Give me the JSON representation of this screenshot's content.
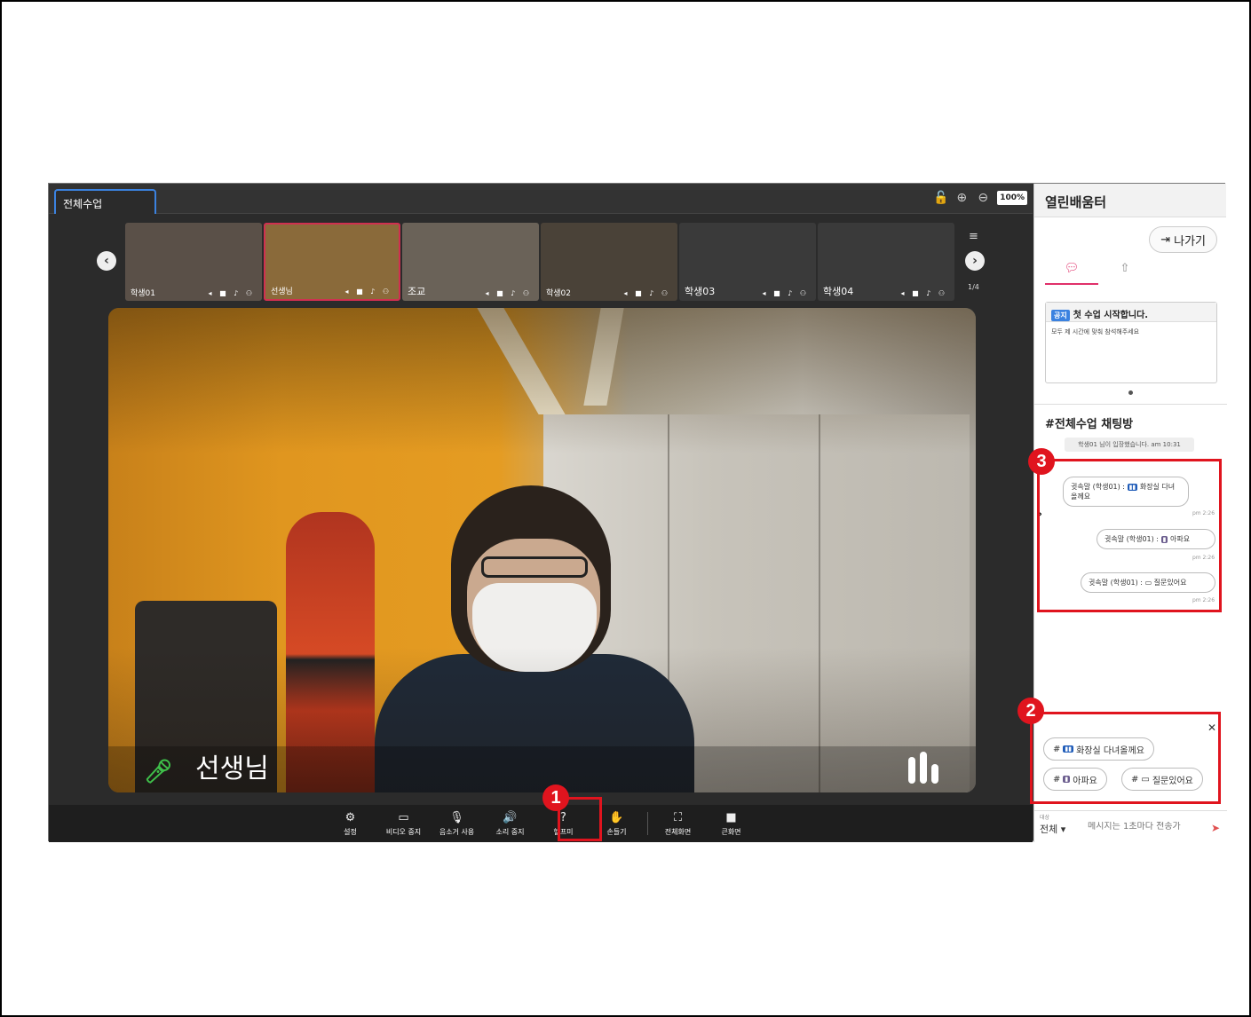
{
  "tab": {
    "label": "전체수업"
  },
  "top_controls": {
    "zoom": "100%"
  },
  "thumbnails": [
    {
      "name": "학생01",
      "bg": "#5a5048"
    },
    {
      "name": "선생님",
      "bg": "#8a6a3a",
      "active": true
    },
    {
      "name": "조교",
      "bg": "#6a6258"
    },
    {
      "name": "학생02",
      "bg": "#4a4238"
    },
    {
      "name": "학생03",
      "bg": "#3a3a3a"
    },
    {
      "name": "학생04",
      "bg": "#3a3a3a"
    }
  ],
  "pagination": "1/4",
  "main_video": {
    "speaker": "선생님"
  },
  "toolbar": [
    {
      "icon": "gear-icon",
      "glyph": "⚙",
      "label": "설정"
    },
    {
      "icon": "video-icon",
      "glyph": "▭",
      "label": "비디오 중지"
    },
    {
      "icon": "mic-icon",
      "glyph": "🎙",
      "label": "음소거 사용"
    },
    {
      "icon": "speaker-icon",
      "glyph": "🔊",
      "label": "소리 중지"
    },
    {
      "icon": "help-icon",
      "glyph": "?",
      "label": "헬프미"
    },
    {
      "icon": "hand-icon",
      "glyph": "✋",
      "label": "손들기"
    },
    {
      "icon": "fullscreen-icon",
      "glyph": "⛶",
      "label": "전체화면"
    },
    {
      "icon": "large-screen-icon",
      "glyph": "■",
      "label": "큰화면"
    }
  ],
  "panel": {
    "title": "열린배움터",
    "exit_label": "나가기",
    "notice": {
      "badge": "공지",
      "title": "첫 수업 시작합니다.",
      "body": "모두 제 시간에 맞춰 참석해주세요"
    },
    "chat_title": "#전체수업 채팅방",
    "system_message": "학생01 님이 입장했습니다. am 10:31",
    "messages": [
      {
        "prefix": "귓속말 (학생01) :",
        "emoji": "🚻",
        "text": "화장실 다녀올께요",
        "time": "pm 2:26"
      },
      {
        "prefix": "귓속말 (학생01) :",
        "emoji": "🤒",
        "text": "아파요",
        "time": "pm 2:26"
      },
      {
        "prefix": "귓속말 (학생01) :",
        "emoji": "💬",
        "text": "질문있어요",
        "time": "pm 2:26"
      }
    ],
    "quick_replies": [
      {
        "tag": "#",
        "emoji": "🚻",
        "text": "화장실 다녀올께요"
      },
      {
        "tag": "#",
        "emoji": "🤒",
        "text": "아파요"
      },
      {
        "tag": "#",
        "emoji": "💬",
        "text": "질문있어요"
      }
    ],
    "input": {
      "target_label": "대상",
      "target_value": "전체",
      "placeholder": "메시지는 1초마다 전송가"
    }
  },
  "callouts": [
    "1",
    "2",
    "3"
  ],
  "colors": {
    "highlight": "#e0141e",
    "accent": "#e0306a",
    "tab_border": "#3b82e0"
  }
}
